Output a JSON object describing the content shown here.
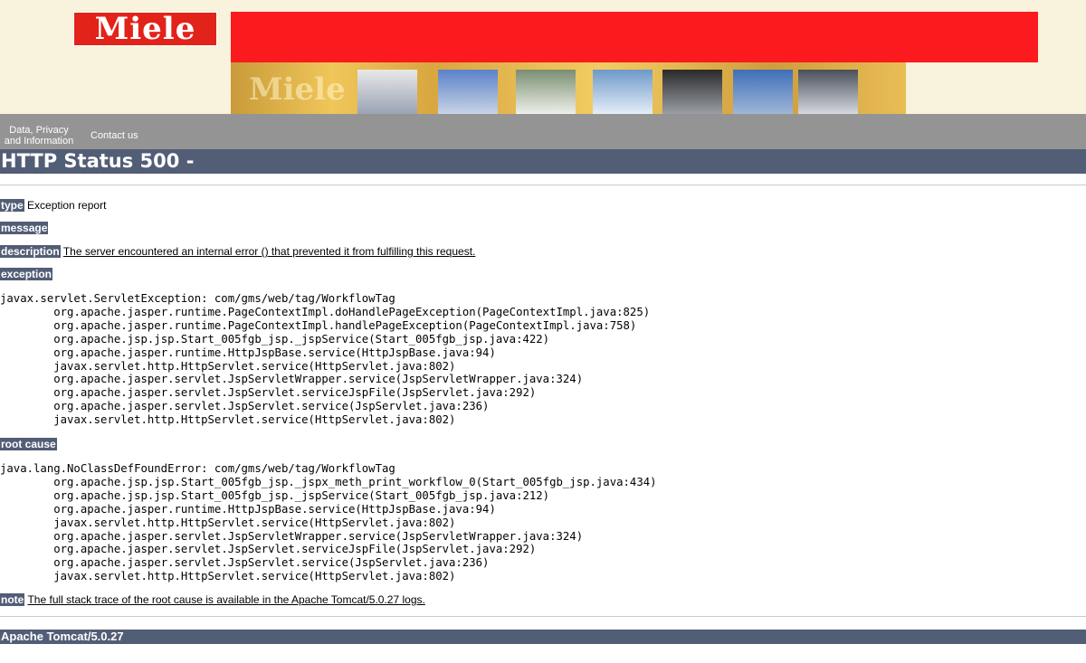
{
  "header": {
    "logo_text": "Miele",
    "strip_brand_text": "Miele",
    "colors": {
      "logo_red": "#e2231a",
      "banner_red": "#fb1a1e",
      "header_bg": "#f9f2dc"
    }
  },
  "nav": {
    "privacy": "Data, Privacy and Information",
    "contact": "Contact us"
  },
  "page_title": "HTTP Status 500 -",
  "report": {
    "type_label": "type",
    "type_value": "Exception report",
    "message_label": "message",
    "description_label": "description",
    "description_value": "The server encountered an internal error () that prevented it from fulfilling this request.",
    "exception_label": "exception",
    "exception_trace": "javax.servlet.ServletException: com/gms/web/tag/WorkflowTag\n\torg.apache.jasper.runtime.PageContextImpl.doHandlePageException(PageContextImpl.java:825)\n\torg.apache.jasper.runtime.PageContextImpl.handlePageException(PageContextImpl.java:758)\n\torg.apache.jsp.jsp.Start_005fgb_jsp._jspService(Start_005fgb_jsp.java:422)\n\torg.apache.jasper.runtime.HttpJspBase.service(HttpJspBase.java:94)\n\tjavax.servlet.http.HttpServlet.service(HttpServlet.java:802)\n\torg.apache.jasper.servlet.JspServletWrapper.service(JspServletWrapper.java:324)\n\torg.apache.jasper.servlet.JspServlet.serviceJspFile(JspServlet.java:292)\n\torg.apache.jasper.servlet.JspServlet.service(JspServlet.java:236)\n\tjavax.servlet.http.HttpServlet.service(HttpServlet.java:802)",
    "root_cause_label": "root cause",
    "root_cause_trace": "java.lang.NoClassDefFoundError: com/gms/web/tag/WorkflowTag\n\torg.apache.jsp.jsp.Start_005fgb_jsp._jspx_meth_print_workflow_0(Start_005fgb_jsp.java:434)\n\torg.apache.jsp.jsp.Start_005fgb_jsp._jspService(Start_005fgb_jsp.java:212)\n\torg.apache.jasper.runtime.HttpJspBase.service(HttpJspBase.java:94)\n\tjavax.servlet.http.HttpServlet.service(HttpServlet.java:802)\n\torg.apache.jasper.servlet.JspServletWrapper.service(JspServletWrapper.java:324)\n\torg.apache.jasper.servlet.JspServlet.serviceJspFile(JspServlet.java:292)\n\torg.apache.jasper.servlet.JspServlet.service(JspServlet.java:236)\n\tjavax.servlet.http.HttpServlet.service(HttpServlet.java:802)",
    "note_label": "note",
    "note_value": "The full stack trace of the root cause is available in the Apache Tomcat/5.0.27 logs."
  },
  "footer": "Apache Tomcat/5.0.27"
}
